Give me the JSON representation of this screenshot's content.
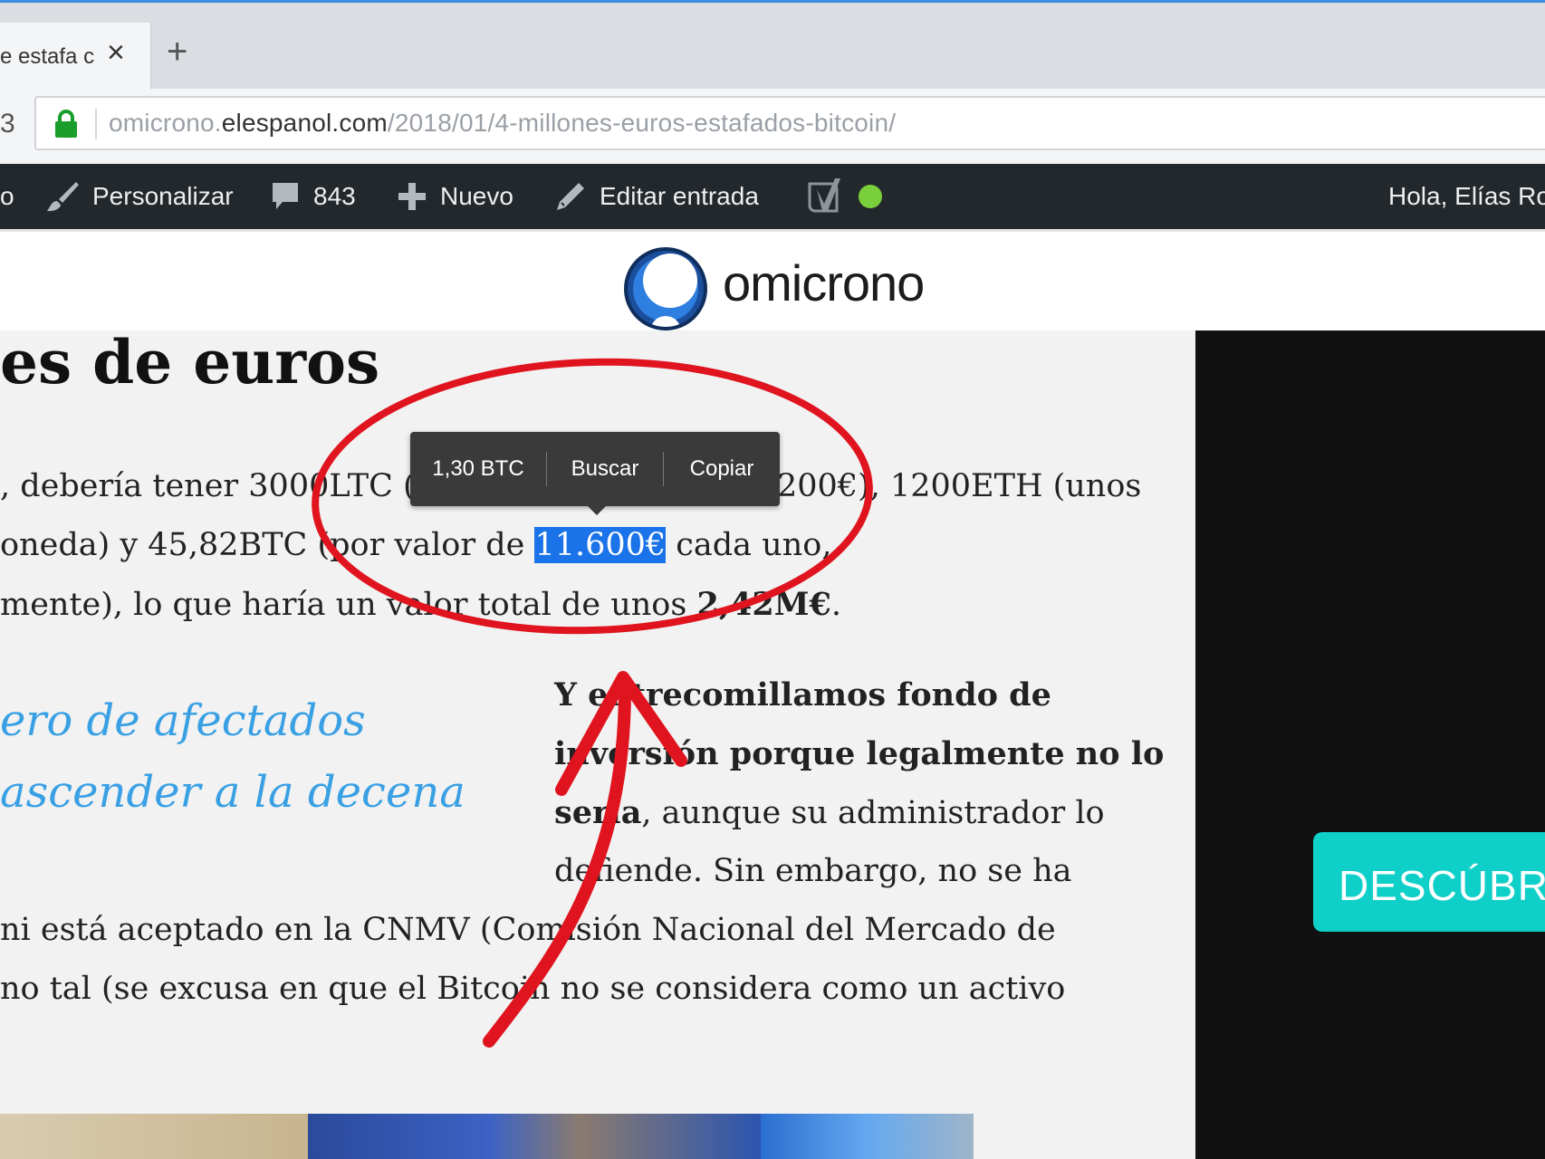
{
  "browser": {
    "tab_title": "e estafa c",
    "tab_close_icon": "×",
    "new_tab_icon": "+",
    "nav_partial_glyph": "3",
    "url_prefix": "omicrono.",
    "url_host": "elespanol.com",
    "url_path": "/2018/01/4-millones-euros-estafados-bitcoin/"
  },
  "adminbar": {
    "partial_left": "o",
    "customize": "Personalizar",
    "comments_count": "843",
    "new": "Nuevo",
    "edit_post": "Editar entrada",
    "greeting": "Hola, Elías Ro"
  },
  "site": {
    "logo_text": "omicrono"
  },
  "article": {
    "headline": "es de euros",
    "p1": {
      "l1": ", debería tener 3000LTC (c",
      "l1_b": "200€), 1200ETH (unos",
      "l2_a": "oneda) y 45,82BTC (por valor de ",
      "l2_sel": "11.600€",
      "l2_b": " cada uno,",
      "l3_a": "mente), lo que haría un valor total de unos ",
      "l3_b": "2,42M€",
      "l3_c": "."
    },
    "pullquote": {
      "l1": "ero de afectados",
      "l2": "ascender a la decena"
    },
    "p2": {
      "l1": "Y entrecomillamos fondo de",
      "l2": "inversión porque legalmente no lo",
      "l3_bold": "sería",
      "l3_rest": ", aunque su administrador lo",
      "l4": "defiende. Sin embargo, no se ha",
      "l5": " ni está aceptado en la CNMV (Comisión Nacional del Mercado de",
      "l6": "no tal (se excusa en que el Bitcoin no se considera como un activo"
    }
  },
  "sidebar": {
    "cta_label": "DESCÚBR"
  },
  "popup": {
    "conversion": "1,30 BTC",
    "search": "Buscar",
    "copy": "Copiar"
  },
  "colors": {
    "admin_bg": "#23282d",
    "selection": "#1a73e8",
    "quote": "#3aa0e4",
    "cta": "#0fcfc9",
    "annotation": "#e0141e",
    "status_dot": "#7ad03a"
  }
}
